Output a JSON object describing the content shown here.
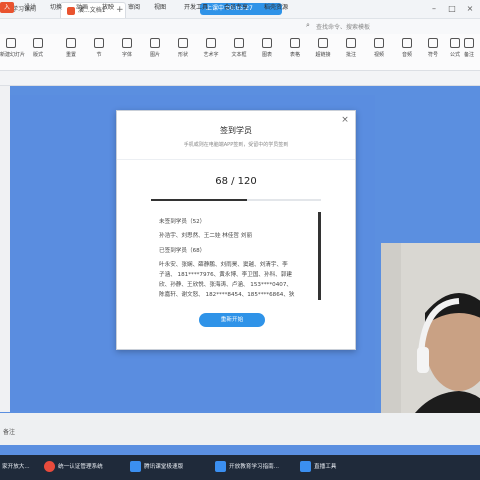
{
  "tabs": [
    {
      "label": "务学习课间"
    },
    {
      "label": "演...文档1"
    },
    {
      "label": "上课中 00:05:27"
    }
  ],
  "menus": [
    "入",
    "设计",
    "切换",
    "动画",
    "放映",
    "审阅",
    "视图",
    "开发工具",
    "会员专享",
    "稻壳资源"
  ],
  "search_placeholder": "查找命令、搜索模板",
  "ribbon": [
    "新建幻灯片",
    "版式",
    "重置",
    "节",
    "字体",
    "图片",
    "形状",
    "艺术字",
    "文本框",
    "图表",
    "表格",
    "超链接",
    "批注",
    "视频",
    "音频",
    "符号",
    "公式",
    "备注"
  ],
  "dialog": {
    "title": "签到学员",
    "subtitle": "手机或则在电脑端APP签到，受留中的学员签到",
    "close": "×",
    "count": "68 / 120",
    "progress": 0.567,
    "signed_header": "未签到学员（52）",
    "signed_names": "孙浩宇、刘思然、王二娃 林佳哲 刘丽",
    "unsigned_header": "已签到学员（68）",
    "unsigned_lines": [
      "叶永安、张娴、薛静鹏、刘雨昊、窦越、刘清宇、李",
      "子涵、 181****7976、黄永博、李卫国、孙科、郭建",
      "欣、孙静、王欣悦、张海涛、卢涵、 153****0407、",
      "陈嘉轩、谢文怒、 182****8454、185****6864、狄"
    ],
    "button": "重新开始"
  },
  "status": "备注",
  "taskbar": [
    "家开放大...",
    "统一认证管理系统",
    "腾讯课堂极速版",
    "开放教育学习指南...",
    "直播工具"
  ]
}
